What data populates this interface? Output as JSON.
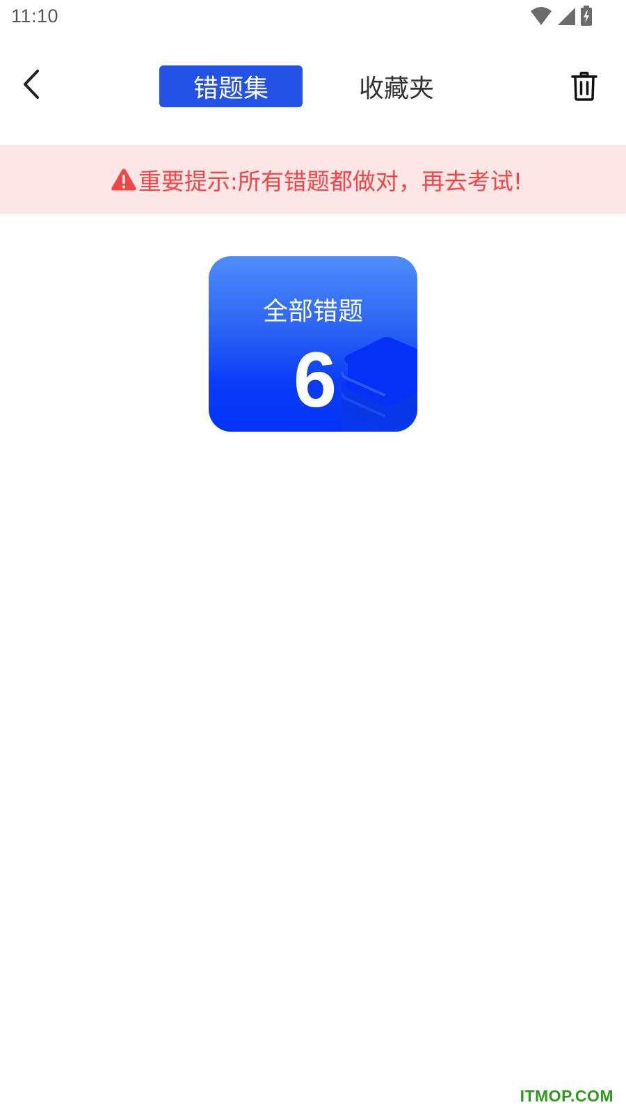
{
  "status_bar": {
    "time": "11:10",
    "icons": [
      "wifi-icon",
      "signal-icon",
      "battery-charging-icon"
    ]
  },
  "nav": {
    "back_icon": "chevron-left-icon",
    "tabs": [
      {
        "label": "错题集",
        "active": true
      },
      {
        "label": "收藏夹",
        "active": false
      }
    ],
    "trash_icon": "trash-icon"
  },
  "notice": {
    "icon": "warning-triangle-icon",
    "text": "重要提示:所有错题都做对，再去考试!"
  },
  "card": {
    "title": "全部错题",
    "count": "6",
    "icon": "layers-icon"
  },
  "watermark": "ITMOP.COM",
  "colors": {
    "accent": "#2451e6",
    "notice_bg": "#fde6e6",
    "notice_text": "#f24545",
    "card_top": "#4f8dfb",
    "card_bottom": "#0533f6",
    "watermark": "#2d9a1c"
  }
}
